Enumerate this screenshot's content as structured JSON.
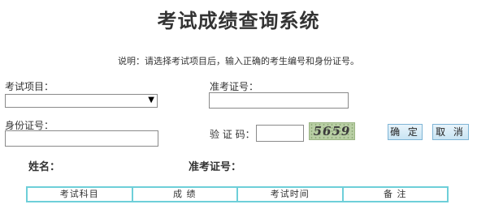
{
  "header": {
    "title": "考试成绩查询系统",
    "note": "说明：请选择考试项目后，输入正确的考生编号和身份证号。"
  },
  "form": {
    "exam_item_label": "考试项目：",
    "exam_item_value": "",
    "exam_number_label": "准考证号：",
    "exam_number_value": "",
    "id_number_label": "身份证号：",
    "id_number_value": "",
    "captcha_label": "验 证 码：",
    "captcha_value": "",
    "captcha_code": "5659",
    "confirm_label": "确 定",
    "cancel_label": "取 消"
  },
  "result_info": {
    "name_label": "姓名：",
    "exam_number_label": "准考证号："
  },
  "results_table": {
    "columns": [
      "考试科目",
      "成 绩",
      "考试时间",
      "备 注"
    ]
  },
  "colors": {
    "table_border": "#6ecfd9",
    "button_border": "#7fb5d6",
    "captcha_bg": "#b9cfa5"
  }
}
